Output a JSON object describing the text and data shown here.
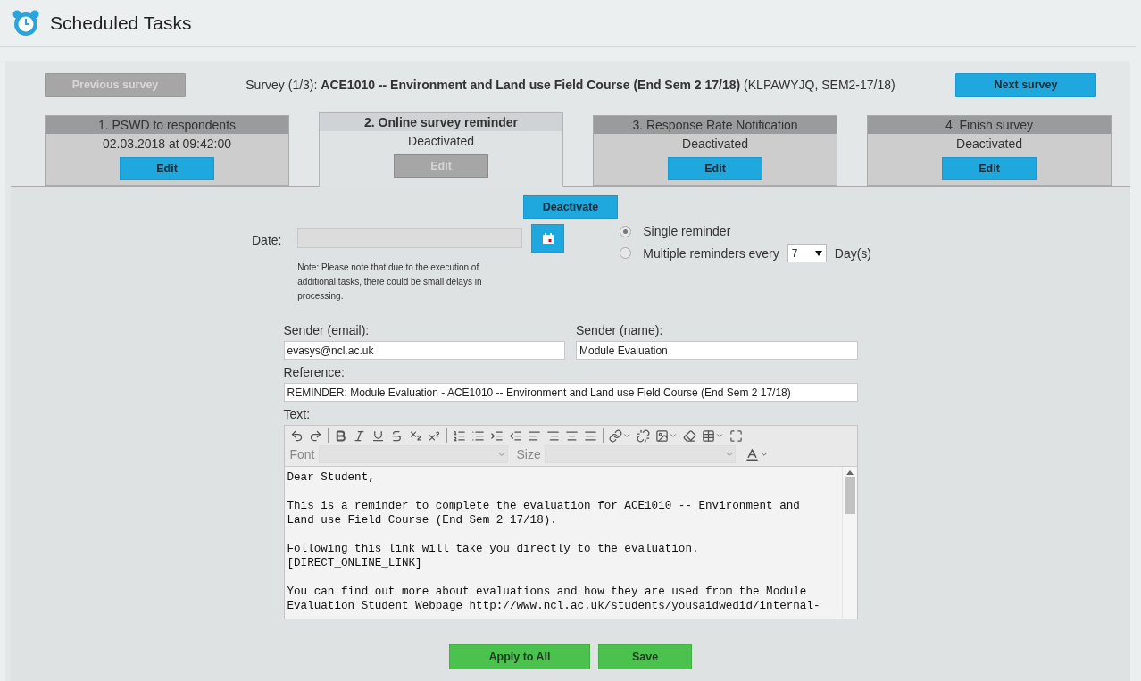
{
  "header": {
    "title": "Scheduled Tasks"
  },
  "survey_nav": {
    "previous": {
      "label": "Previous survey",
      "disabled": true
    },
    "survey_prefix": "Survey (1/3):",
    "survey_title": "ACE1010 -- Environment and Land use Field Course (End Sem 2 17/18)",
    "survey_codes": "(KLPAWYJQ, SEM2-17/18)",
    "next": {
      "label": "Next survey",
      "disabled": false
    }
  },
  "tabs": [
    {
      "label": "1. PSWD to respondents",
      "status": "02.03.2018 at 09:42:00",
      "button": "Edit",
      "selected": false
    },
    {
      "label": "2. Online survey reminder",
      "status": "Deactivated",
      "button": "Edit",
      "selected": true
    },
    {
      "label": "3. Response Rate Notification",
      "status": "Deactivated",
      "button": "Edit",
      "selected": false
    },
    {
      "label": "4. Finish survey",
      "status": "Deactivated",
      "button": "Edit",
      "selected": false
    }
  ],
  "deactivate_button": "Deactivate",
  "date": {
    "label": "Date:",
    "disabled": true,
    "note": "Note: Please note that due to the execution of additional tasks, there could be small delays in processing."
  },
  "reminder_options": [
    {
      "label": "Single reminder",
      "selected": true
    },
    {
      "label": "Multiple reminders every",
      "selected": false
    }
  ],
  "interval": {
    "value": "7",
    "unit": "Day(s)"
  },
  "sender_email": {
    "label": "Sender (email):",
    "value": "evasys@ncl.ac.uk"
  },
  "sender_name": {
    "label": "Sender (name):",
    "value": "Module Evaluation"
  },
  "reference": {
    "label": "Reference:",
    "value": "REMINDER: Module Evaluation - ACE1010 -- Environment and Land use Field Course (End Sem 2 17/18)"
  },
  "text": {
    "label": "Text:",
    "font_label": "Font",
    "size_label": "Size",
    "paragraphs": [
      [
        "Dear Student,"
      ],
      [
        "This is a reminder to complete the evaluation for ACE1010 -- Environment and",
        "Land use Field Course (End Sem 2 17/18)."
      ],
      [
        "Following this link will take you directly to the evaluation.",
        "[DIRECT_ONLINE_LINK]"
      ],
      [
        "You can find out more about evaluations and how they are used from the Module",
        "Evaluation Student Webpage http://www.ncl.ac.uk/students/yousaidwedid/internal-"
      ]
    ]
  },
  "actions": [
    {
      "label": "Apply to All"
    },
    {
      "label": "Save"
    }
  ]
}
